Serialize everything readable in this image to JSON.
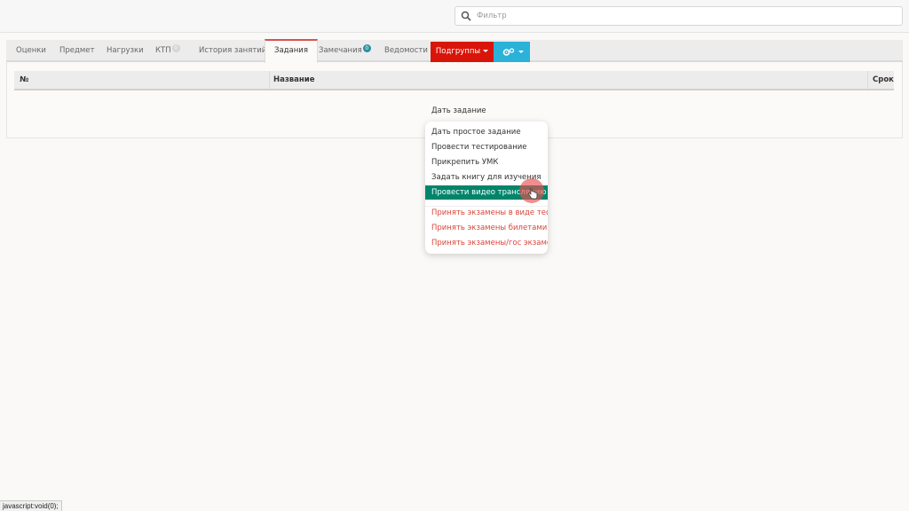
{
  "search": {
    "placeholder": "Фильтр"
  },
  "tabs": [
    {
      "label": "Оценки"
    },
    {
      "label": "Предмет"
    },
    {
      "label": "Нагрузки"
    },
    {
      "label": "КТП",
      "badge": "0"
    },
    {
      "label": "История занятий"
    },
    {
      "label": "Задания",
      "active": true
    },
    {
      "label": "Замечания",
      "badge": "0"
    },
    {
      "label": "Ведомости"
    }
  ],
  "buttons": {
    "subgroups": "Подгруппы"
  },
  "table": {
    "columns": [
      "№",
      "Название",
      "Срок"
    ]
  },
  "dropdown": {
    "toggle": "Дать задание",
    "items": [
      {
        "label": "Дать простое задание"
      },
      {
        "label": "Провести тестирование"
      },
      {
        "label": "Прикрепить УМК"
      },
      {
        "label": "Задать книгу для изучения"
      },
      {
        "label": "Провести видео трансляцию",
        "highlighted": true
      },
      {
        "label": "Принять экзамены в виде тестов",
        "style": "danger"
      },
      {
        "label": "Принять экзамены билетами",
        "style": "danger"
      },
      {
        "label": "Принять экзамены/гос экзамен",
        "style": "danger"
      }
    ]
  },
  "status_bar": {
    "text": "javascript:void(0);"
  },
  "colors": {
    "red_button": "#d9150a",
    "blue_button": "#2ab2d8",
    "highlight": "#00856a",
    "danger_text": "#d9453b"
  }
}
